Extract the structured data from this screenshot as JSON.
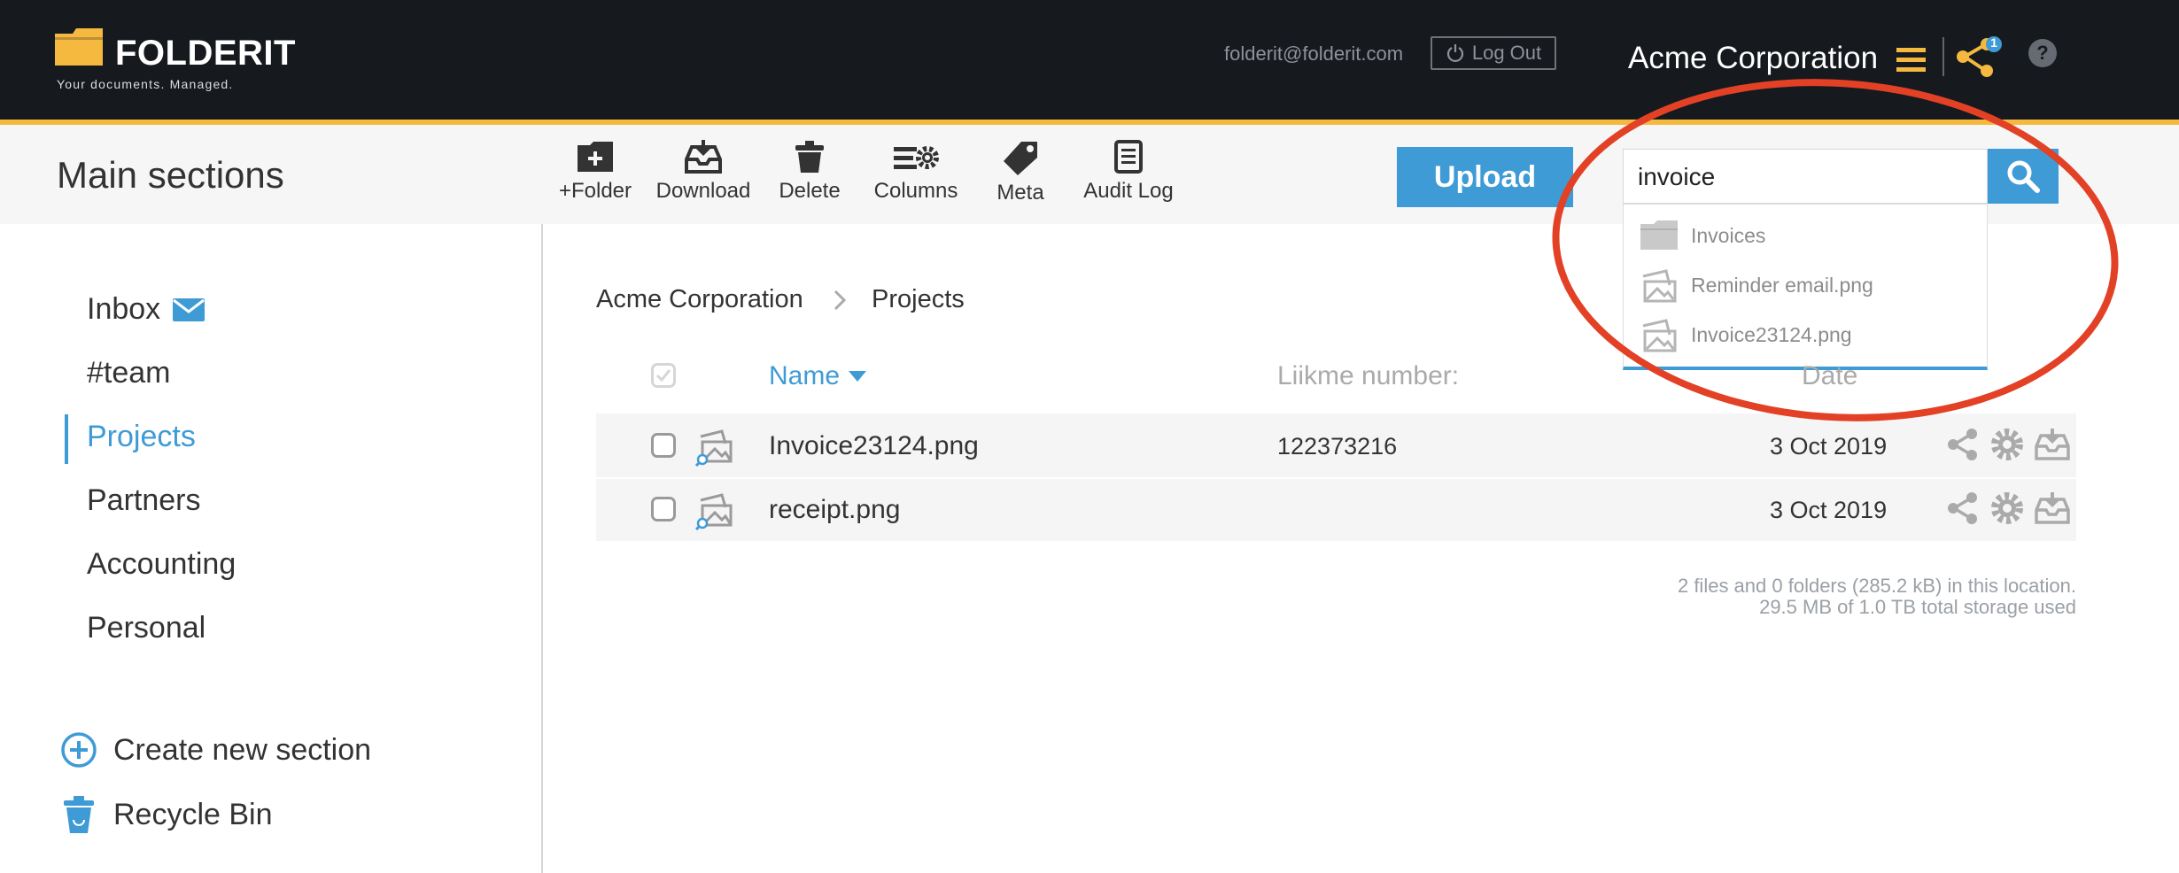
{
  "header": {
    "logo_text": "FOLDERIT",
    "logo_tagline": "Your documents. Managed.",
    "user_email": "folderit@folderit.com",
    "logout_label": "Log Out",
    "organization": "Acme Corporation",
    "share_badge_count": "1",
    "help_label": "?"
  },
  "toolbar": {
    "section_title": "Main sections",
    "tools": [
      {
        "label": "+Folder",
        "icon": "folder-plus-icon"
      },
      {
        "label": "Download",
        "icon": "download-tray-icon"
      },
      {
        "label": "Delete",
        "icon": "trash-icon"
      },
      {
        "label": "Columns",
        "icon": "columns-gear-icon"
      },
      {
        "label": "Meta",
        "icon": "tag-icon"
      },
      {
        "label": "Audit Log",
        "icon": "document-list-icon"
      }
    ],
    "upload_label": "Upload"
  },
  "search": {
    "value": "invoice",
    "suggestions": [
      {
        "label": "Invoices",
        "icon": "folder-icon"
      },
      {
        "label": "Reminder email.png",
        "icon": "image-file-icon"
      },
      {
        "label": "Invoice23124.png",
        "icon": "image-file-icon"
      }
    ]
  },
  "sidebar": {
    "items": [
      {
        "label": "Inbox",
        "active": false
      },
      {
        "label": "#team",
        "active": false
      },
      {
        "label": "Projects",
        "active": true
      },
      {
        "label": "Partners",
        "active": false
      },
      {
        "label": "Accounting",
        "active": false
      },
      {
        "label": "Personal",
        "active": false
      }
    ],
    "create_label": "Create new section",
    "recycle_label": "Recycle Bin"
  },
  "breadcrumb": [
    "Acme Corporation",
    "Projects"
  ],
  "table": {
    "columns": {
      "name": "Name",
      "meta": "Liikme number:",
      "date": "Date"
    },
    "rows": [
      {
        "name": "Invoice23124.png",
        "meta": "122373216",
        "date": "3 Oct 2019"
      },
      {
        "name": "receipt.png",
        "meta": "",
        "date": "3 Oct 2019"
      }
    ]
  },
  "summary": {
    "line1": "2 files and 0 folders (285.2 kB) in this location.",
    "line2": "29.5 MB of 1.0 TB total storage used"
  },
  "colors": {
    "accent": "#3f9bd6",
    "brand_yellow": "#f5b93f",
    "annotation_red": "#e24125",
    "header_bg": "#16191e"
  }
}
